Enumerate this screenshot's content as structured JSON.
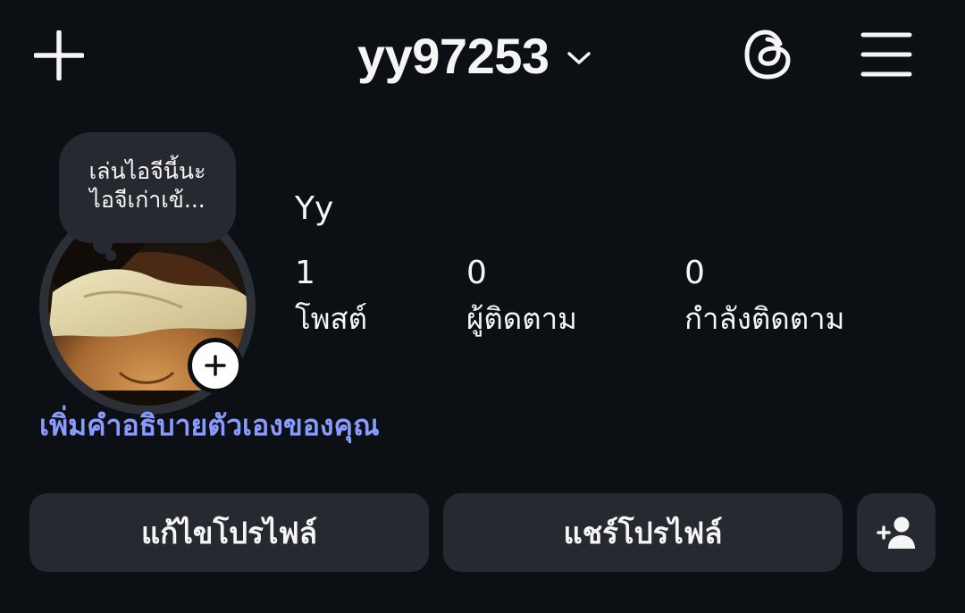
{
  "header": {
    "username": "yy97253",
    "icons": {
      "create": "plus-icon",
      "account_switch": "chevron-down-icon",
      "threads": "threads-icon",
      "menu": "hamburger-menu-icon"
    }
  },
  "note": {
    "line1": "เล่นไอจีนี้นะ",
    "line2": "ไอจีเก่าเข้..."
  },
  "profile": {
    "display_name": "Yy",
    "avatar_icon": "add-story-plus-icon"
  },
  "stats": [
    {
      "count": "1",
      "label": "โพสต์"
    },
    {
      "count": "0",
      "label": "ผู้ติดตาม"
    },
    {
      "count": "0",
      "label": "กำลังติดตาม"
    }
  ],
  "bio": {
    "add_bio_label": "เพิ่มคำอธิบายตัวเองของคุณ"
  },
  "actions": {
    "edit_profile": "แก้ไขโปรไฟล์",
    "share_profile": "แชร์โปรไฟล์",
    "discover_people_icon": "add-person-icon"
  },
  "colors": {
    "background": "#0c1014",
    "surface": "#262a30",
    "text": "#f5f5f5",
    "link": "#8a9bff"
  }
}
